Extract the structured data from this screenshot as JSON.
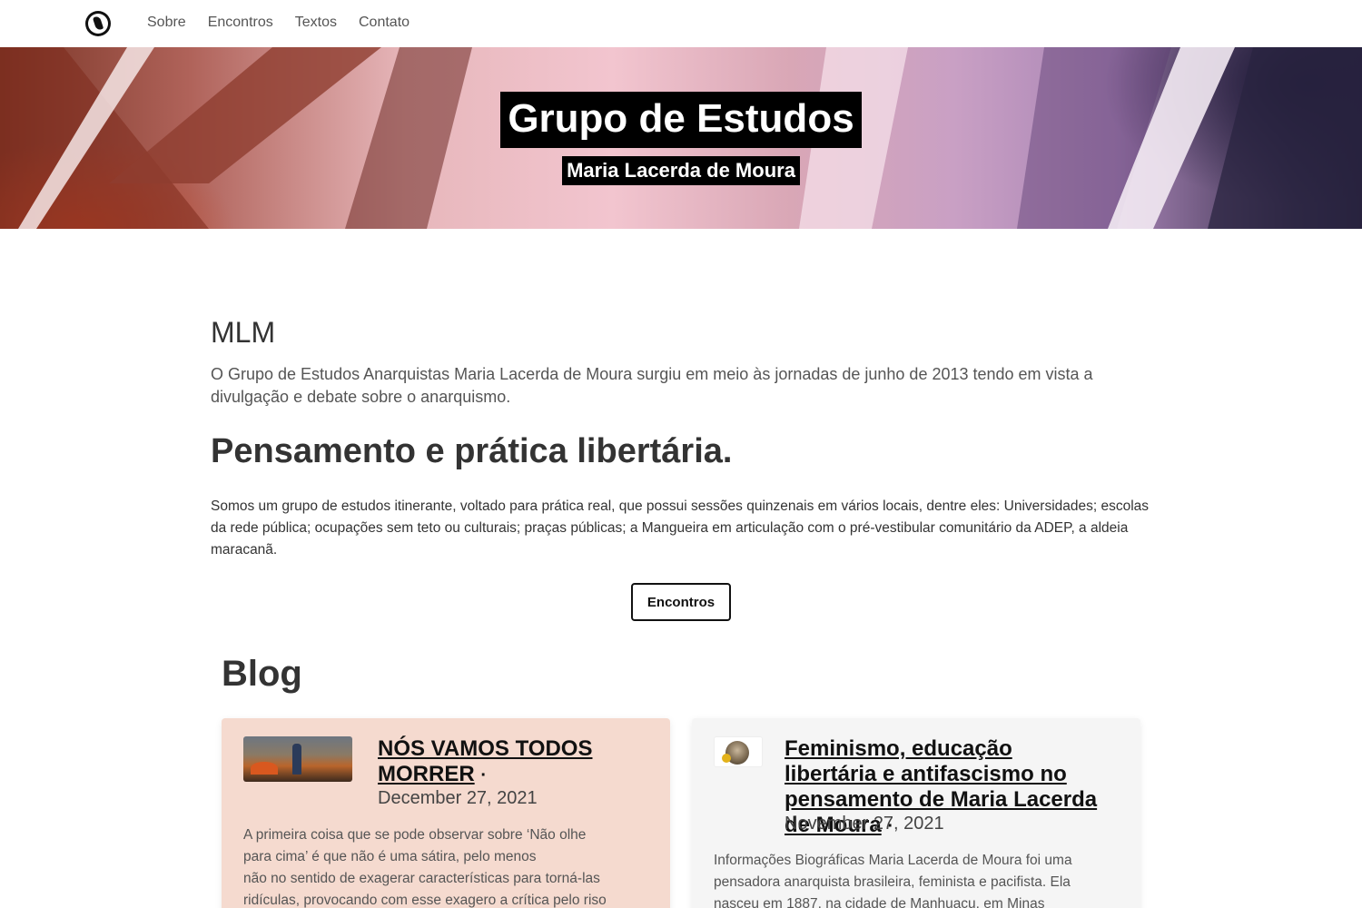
{
  "nav": {
    "logo": "anarchist-portrait-logo",
    "links": [
      "Sobre",
      "Encontros",
      "Textos",
      "Contato"
    ]
  },
  "hero": {
    "title": "Grupo de Estudos",
    "subtitle": "Maria Lacerda de Moura"
  },
  "about": {
    "heading": "MLM",
    "intro": "O Grupo de Estudos Anarquistas Maria Lacerda de Moura surgiu em meio às jornadas de junho de 2013 tendo em vista a divulgação e debate sobre o anarquismo.",
    "tagline": "Pensamento e prática libertária.",
    "description": "Somos um grupo de estudos itinerante, voltado para prática real, que possui sessões quinzenais em vários locais, dentre eles: Universidades; escolas da rede pública; ocupações sem teto ou culturais; praças públicas; a Mangueira em articulação com o pré-vestibular comunitário da ADEP, a aldeia maracanã.",
    "button": "Encontros"
  },
  "blog": {
    "heading": "Blog",
    "posts": [
      {
        "title": "NÓS VAMOS TODOS MORRER",
        "separator": "·",
        "date": "December 27, 2021",
        "excerpt_lines": [
          "A primeira coisa que se pode observar sobre ‘Não olhe",
          "para cima’ é que não é uma sátira, pelo menos",
          "não no sentido de exagerar características para torná-las",
          "ridículas, provocando com esse exagero a crítica pelo riso"
        ],
        "background": "#f5dacf"
      },
      {
        "title": "Feminismo, educação libertária e antifascismo no pensamento de Maria Lacerda de Moura",
        "separator": "·",
        "date": "November 27, 2021",
        "excerpt_lines": [
          "Informações Biográficas Maria Lacerda de Moura foi uma",
          "pensadora anarquista brasileira, feminista e pacifista. Ela",
          "nasceu em 1887, na cidade de Manhuaçu, em Minas"
        ],
        "background": "#f5f5f5"
      }
    ]
  }
}
